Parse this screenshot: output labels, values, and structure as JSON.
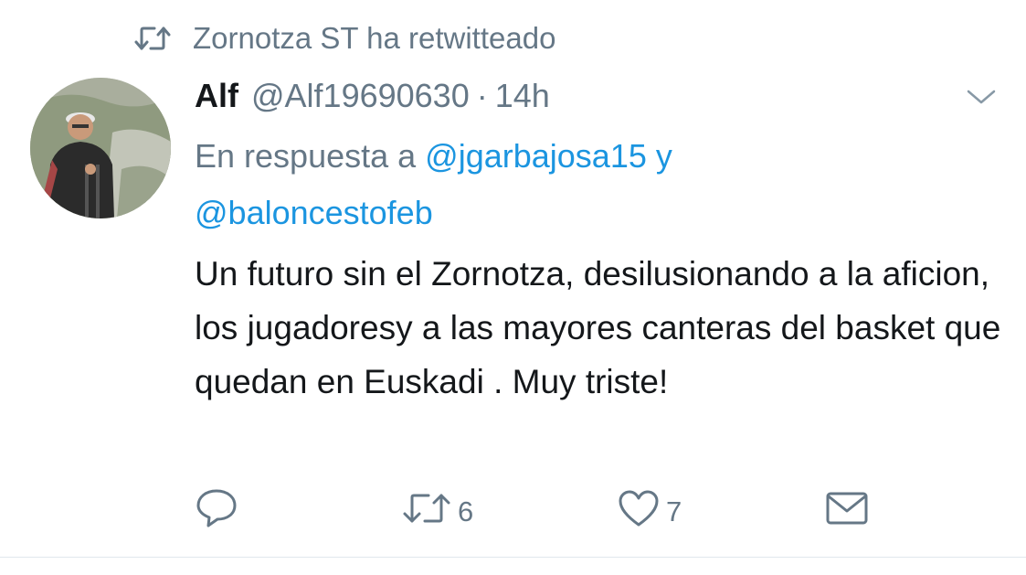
{
  "retweet_header": {
    "icon": "retweet-icon",
    "text": "Zornotza ST ha retwitteado"
  },
  "tweet": {
    "author_name": "Alf",
    "author_handle": "@Alf19690630",
    "separator": "·",
    "time": "14h",
    "reply_prefix": "En respuesta a",
    "reply_mention_1": "@jgarbajosa15",
    "reply_conjunction": "y",
    "reply_mention_2": "@baloncestofeb",
    "text": "Un futuro sin el Zornotza, desilusionando a la aficion, los jugadoresy a las mayores canteras del basket que quedan en Euskadi . Muy triste!"
  },
  "actions": {
    "reply": {
      "icon": "reply-icon",
      "count": ""
    },
    "retweet": {
      "icon": "retweet-icon",
      "count": "6"
    },
    "like": {
      "icon": "heart-icon",
      "count": "7"
    },
    "message": {
      "icon": "mail-icon"
    }
  },
  "colors": {
    "text_primary": "#14171a",
    "text_secondary": "#657786",
    "link": "#1b95e0",
    "divider": "#e1e8ed"
  }
}
